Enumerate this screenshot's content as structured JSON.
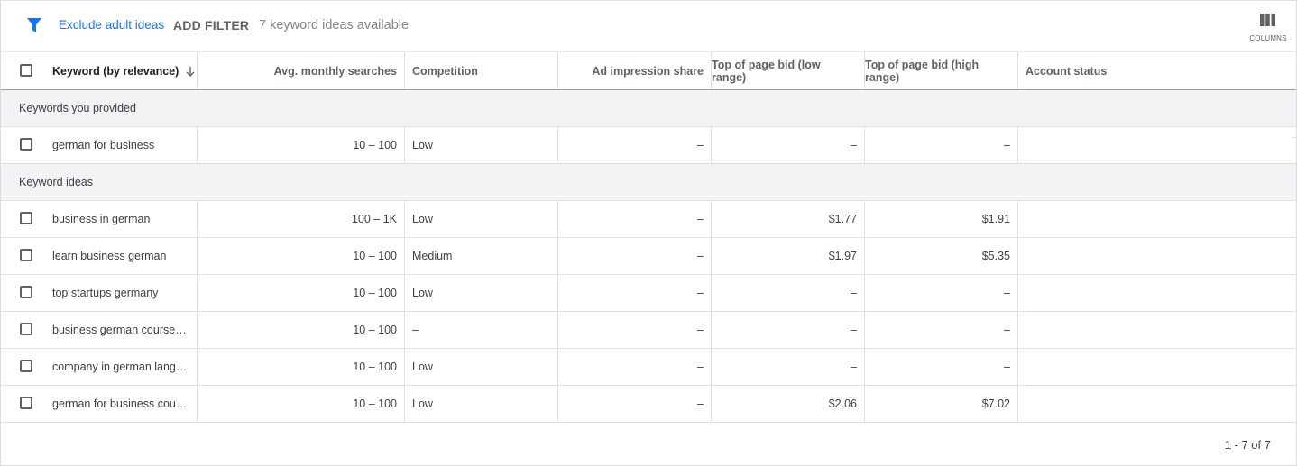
{
  "toolbar": {
    "exclude_link": "Exclude adult ideas",
    "add_filter": "ADD FILTER",
    "ideas_count": "7 keyword ideas available",
    "columns_label": "COLUMNS",
    "filter_icon": "filter-icon",
    "columns_icon": "columns-icon"
  },
  "table": {
    "headers": {
      "keyword": "Keyword (by relevance)",
      "avg_searches": "Avg. monthly searches",
      "competition": "Competition",
      "ad_impression_share": "Ad impression share",
      "bid_low": "Top of page bid (low range)",
      "bid_high": "Top of page bid (high range)",
      "account_status": "Account status"
    },
    "sort_icon": "arrow-down-icon",
    "sections": {
      "provided": "Keywords you provided",
      "ideas": "Keyword ideas"
    },
    "provided_rows": [
      {
        "keyword": "german for business",
        "searches": "10 – 100",
        "competition": "Low",
        "impression": "–",
        "bid_low": "–",
        "bid_high": "–",
        "status": ""
      }
    ],
    "idea_rows": [
      {
        "keyword": "business in german",
        "searches": "100 – 1K",
        "competition": "Low",
        "impression": "–",
        "bid_low": "$1.77",
        "bid_high": "$1.91",
        "status": ""
      },
      {
        "keyword": "learn business german",
        "searches": "10 – 100",
        "competition": "Medium",
        "impression": "–",
        "bid_low": "$1.97",
        "bid_high": "$5.35",
        "status": ""
      },
      {
        "keyword": "top startups germany",
        "searches": "10 – 100",
        "competition": "Low",
        "impression": "–",
        "bid_low": "–",
        "bid_high": "–",
        "status": ""
      },
      {
        "keyword": "business german course b…",
        "searches": "10 – 100",
        "competition": "–",
        "impression": "–",
        "bid_low": "–",
        "bid_high": "–",
        "status": ""
      },
      {
        "keyword": "company in german langua…",
        "searches": "10 – 100",
        "competition": "Low",
        "impression": "–",
        "bid_low": "–",
        "bid_high": "–",
        "status": ""
      },
      {
        "keyword": "german for business course",
        "searches": "10 – 100",
        "competition": "Low",
        "impression": "–",
        "bid_low": "$2.06",
        "bid_high": "$7.02",
        "status": ""
      }
    ]
  },
  "pager": {
    "text": "1 - 7 of 7"
  },
  "colors": {
    "accent": "#1a73e8",
    "section_bg": "#f1f3f4",
    "border": "#e0e0e0"
  }
}
